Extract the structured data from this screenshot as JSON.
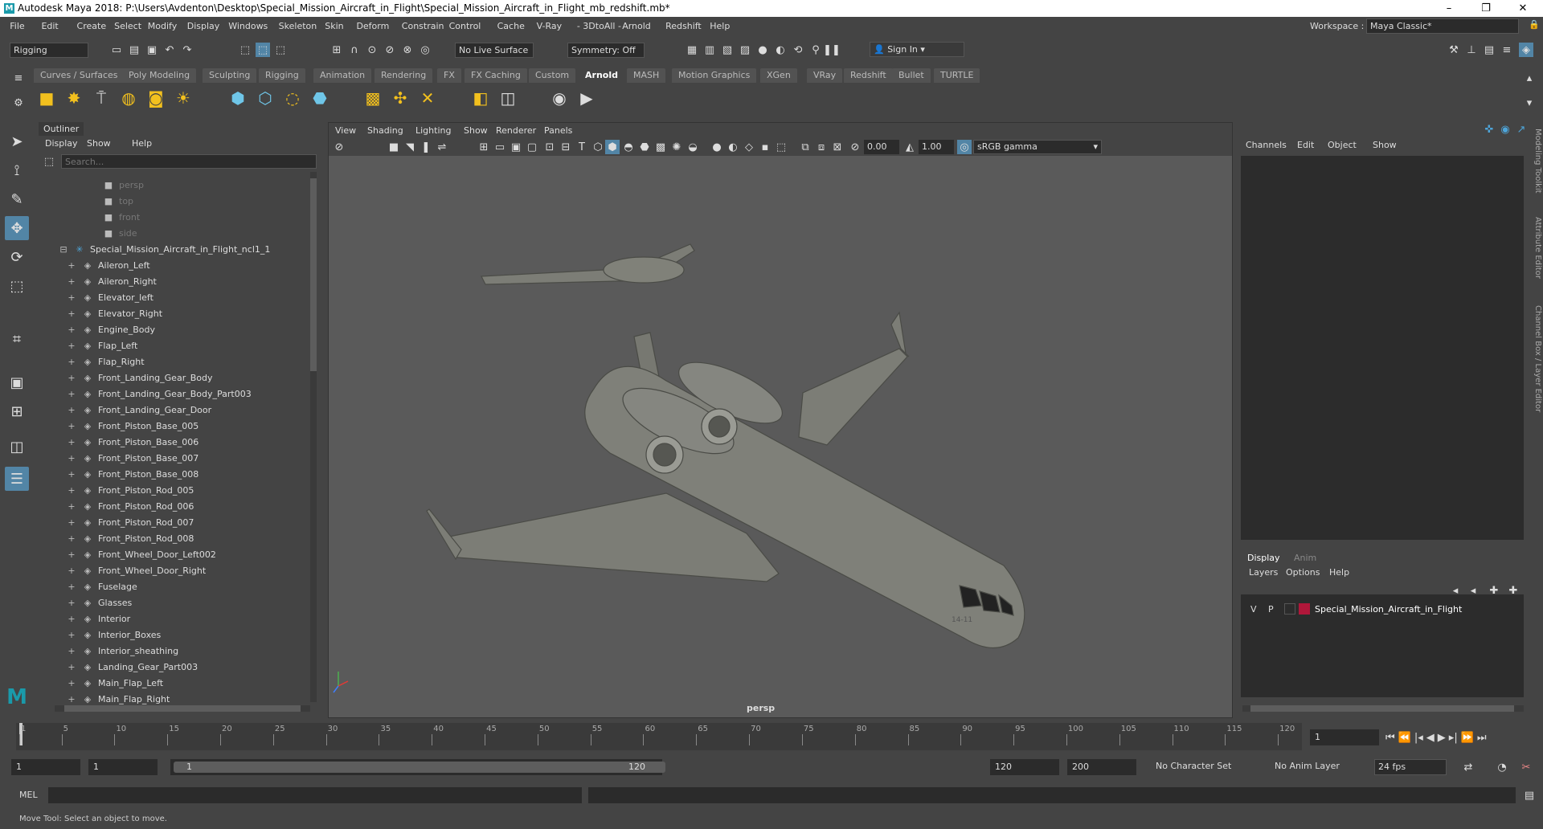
{
  "window": {
    "title": "Autodesk Maya 2018: P:\\Users\\Avdenton\\Desktop\\Special_Mission_Aircraft_in_Flight\\Special_Mission_Aircraft_in_Flight_mb_redshift.mb*",
    "min": "–",
    "max": "❐",
    "close": "✕"
  },
  "menu": [
    "File",
    "Edit",
    "Create",
    "Select",
    "Modify",
    "Display",
    "Windows",
    "Skeleton",
    "Skin",
    "Deform",
    "Constrain",
    "Control",
    "Cache",
    "V-Ray",
    "- 3DtoAll -",
    "Arnold",
    "Redshift",
    "Help"
  ],
  "workspace": {
    "label": "Workspace :",
    "value": "Maya Classic*"
  },
  "status": {
    "menuset": "Rigging",
    "live_surface": "No Live Surface",
    "symmetry": "Symmetry: Off",
    "sign_in": "Sign In"
  },
  "shelf_tabs": [
    "Curves / Surfaces",
    "Poly Modeling",
    "Sculpting",
    "Rigging",
    "Animation",
    "Rendering",
    "FX",
    "FX Caching",
    "Custom",
    "Arnold",
    "MASH",
    "Motion Graphics",
    "XGen",
    "VRay",
    "Redshift",
    "Bullet",
    "TURTLE"
  ],
  "shelf_active": "Arnold",
  "outliner": {
    "title": "Outliner",
    "menu": [
      "Display",
      "Show",
      "Help"
    ],
    "search_placeholder": "Search...",
    "cameras": [
      "persp",
      "top",
      "front",
      "side"
    ],
    "root": "Special_Mission_Aircraft_in_Flight_ncl1_1",
    "items": [
      "Aileron_Left",
      "Aileron_Right",
      "Elevator_left",
      "Elevator_Right",
      "Engine_Body",
      "Flap_Left",
      "Flap_Right",
      "Front_Landing_Gear_Body",
      "Front_Landing_Gear_Body_Part003",
      "Front_Landing_Gear_Door",
      "Front_Piston_Base_005",
      "Front_Piston_Base_006",
      "Front_Piston_Base_007",
      "Front_Piston_Base_008",
      "Front_Piston_Rod_005",
      "Front_Piston_Rod_006",
      "Front_Piston_Rod_007",
      "Front_Piston_Rod_008",
      "Front_Wheel_Door_Left002",
      "Front_Wheel_Door_Right",
      "Fuselage",
      "Glasses",
      "Interior",
      "Interior_Boxes",
      "Interior_sheathing",
      "Landing_Gear_Part003",
      "Main_Flap_Left",
      "Main_Flap_Right"
    ]
  },
  "viewport": {
    "menu": [
      "View",
      "Shading",
      "Lighting",
      "Show",
      "Renderer",
      "Panels"
    ],
    "exposure": "0.00",
    "gamma": "1.00",
    "colorspace": "sRGB gamma",
    "camera_label": "persp",
    "nose_marking": "14-11"
  },
  "channelbox": {
    "menu": [
      "Channels",
      "Edit",
      "Object",
      "Show"
    ],
    "layer_tabs": [
      "Display",
      "Anim"
    ],
    "layer_menu": [
      "Layers",
      "Options",
      "Help"
    ],
    "layer": {
      "v": "V",
      "p": "P",
      "name": "Special_Mission_Aircraft_in_Flight",
      "color": "#b0173a"
    }
  },
  "side_tabs": [
    "Modeling Toolkit",
    "Attribute Editor",
    "Channel Box / Layer Editor"
  ],
  "timeline": {
    "ticks": [
      "1",
      "5",
      "10",
      "15",
      "20",
      "25",
      "30",
      "35",
      "40",
      "45",
      "50",
      "55",
      "60",
      "65",
      "70",
      "75",
      "80",
      "85",
      "90",
      "95",
      "100",
      "105",
      "110",
      "115",
      "120"
    ],
    "current_frame": "1"
  },
  "range": {
    "start": "1",
    "inner_start": "1",
    "slider_start": "1",
    "slider_end": "120",
    "end": "120",
    "max": "200",
    "char_set": "No Character Set",
    "anim_layer": "No Anim Layer",
    "fps": "24 fps"
  },
  "cmd": {
    "label": "MEL"
  },
  "help": "Move Tool: Select an object to move."
}
